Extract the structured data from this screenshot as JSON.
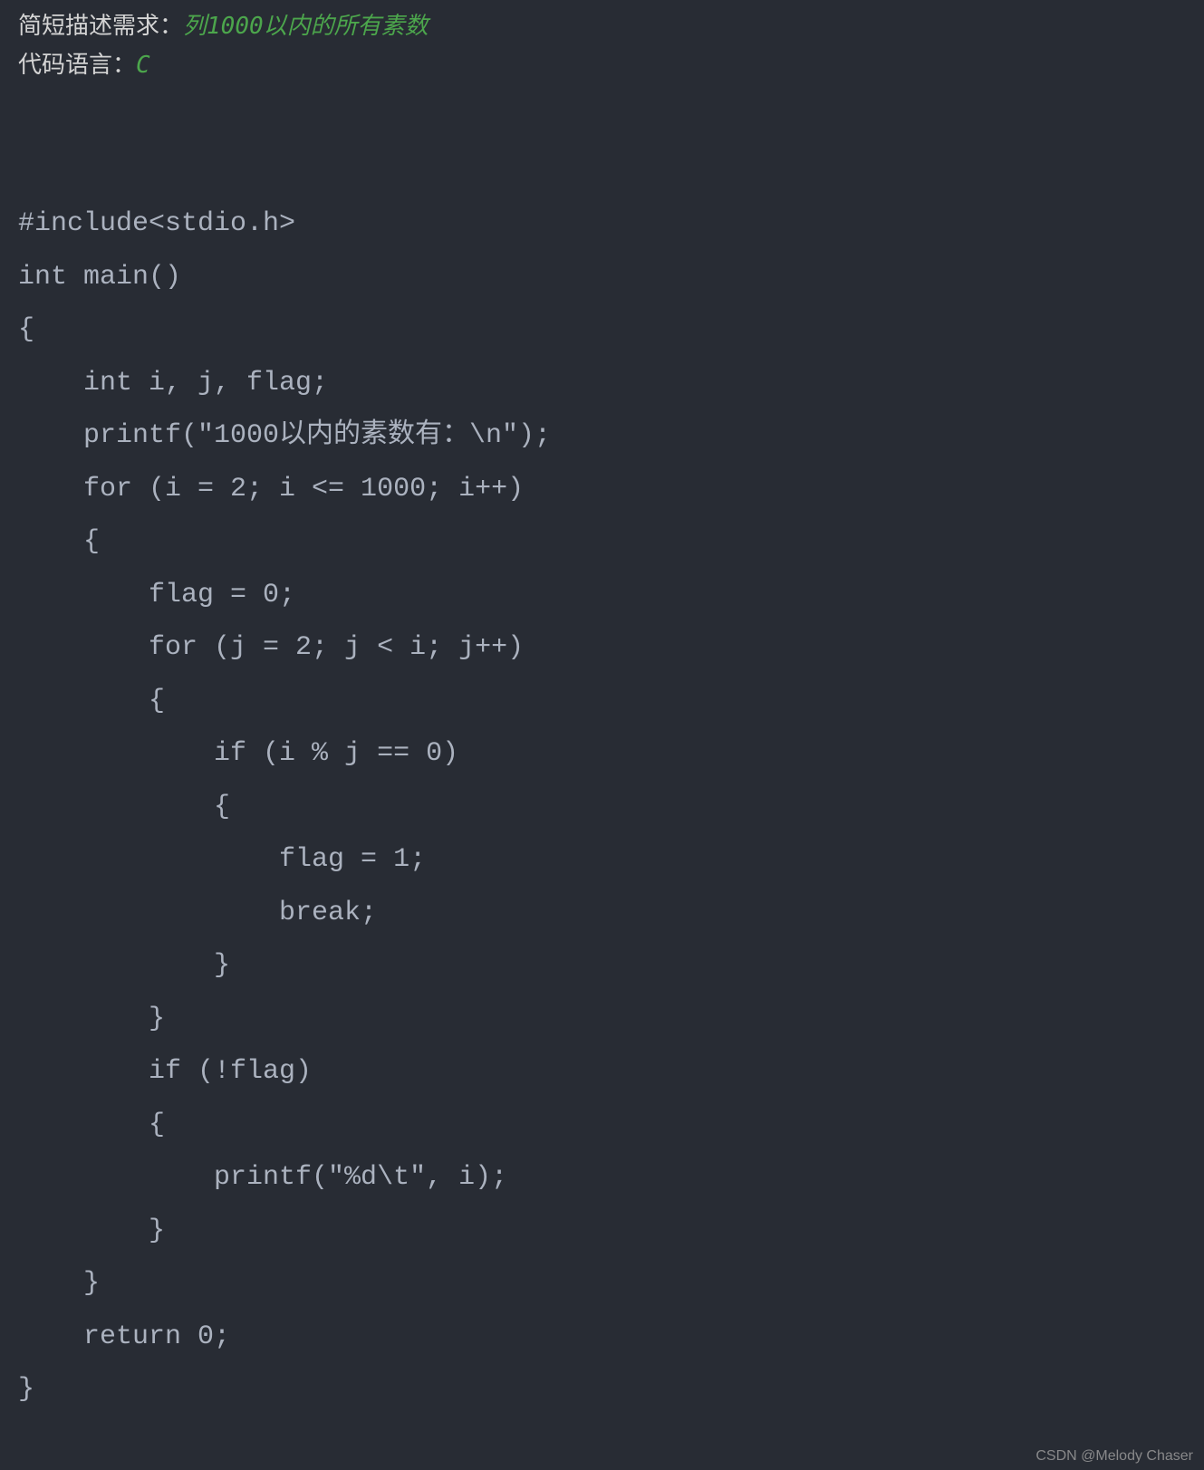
{
  "header": {
    "prompt_label": "简短描述需求：",
    "prompt_pre": "列",
    "prompt_num": "1000",
    "prompt_post": "以内的所有素数",
    "lang_label": "代码语言：",
    "lang_value": "C"
  },
  "code": {
    "line1": "#include<stdio.h>",
    "line2": "int main()",
    "line3": "{",
    "line4": "    int i, j, flag;",
    "line5": "    printf(\"1000以内的素数有：\\n\");",
    "line6": "    for (i = 2; i <= 1000; i++)",
    "line7": "    {",
    "line8": "        flag = 0;",
    "line9": "        for (j = 2; j < i; j++)",
    "line10": "        {",
    "line11": "            if (i % j == 0)",
    "line12": "            {",
    "line13": "                flag = 1;",
    "line14": "                break;",
    "line15": "            }",
    "line16": "        }",
    "line17": "        if (!flag)",
    "line18": "        {",
    "line19": "            printf(\"%d\\t\", i);",
    "line20": "        }",
    "line21": "    }",
    "line22": "    return 0;",
    "line23": "}"
  },
  "watermark": "CSDN @Melody Chaser"
}
